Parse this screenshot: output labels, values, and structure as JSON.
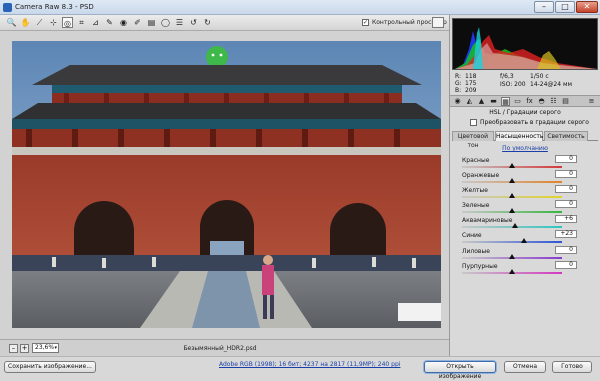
{
  "window": {
    "title": "Camera Raw 8.3  -  PSD",
    "min": "–",
    "max": "□",
    "close": "✕"
  },
  "toolbar": {
    "tools": [
      {
        "name": "zoom-tool",
        "glyph": "🔍"
      },
      {
        "name": "hand-tool",
        "glyph": "✋"
      },
      {
        "name": "white-balance-tool",
        "glyph": "⟋"
      },
      {
        "name": "color-sampler-tool",
        "glyph": "⊹"
      },
      {
        "name": "targeted-adjustment-tool",
        "glyph": "◎"
      },
      {
        "name": "crop-tool",
        "glyph": "⌗"
      },
      {
        "name": "straighten-tool",
        "glyph": "⊿"
      },
      {
        "name": "spot-removal-tool",
        "glyph": "✎"
      },
      {
        "name": "red-eye-tool",
        "glyph": "◉"
      },
      {
        "name": "adjustment-brush-tool",
        "glyph": "✐"
      },
      {
        "name": "graduated-filter-tool",
        "glyph": "▤"
      },
      {
        "name": "radial-filter-tool",
        "glyph": "◯"
      },
      {
        "name": "preferences-tool",
        "glyph": "☰"
      },
      {
        "name": "rotate-left-tool",
        "glyph": "↺"
      },
      {
        "name": "rotate-right-tool",
        "glyph": "↻"
      }
    ],
    "preview_label": "Контрольный просмотр",
    "preview_checked": "✓"
  },
  "statusbar": {
    "zoom_out": "–",
    "zoom_in": "+",
    "zoom_value": "23,6%",
    "zoom_arrow": "▾",
    "filename": "Безымянный_HDR2.psd"
  },
  "camera_info": {
    "r_label": "R:",
    "r_value": "118",
    "g_label": "G:",
    "g_value": "175",
    "b_label": "B:",
    "b_value": "209",
    "aperture": "f/6,3",
    "shutter": "1/50 с",
    "iso": "ISO: 200",
    "lens": "14-24@24 мм"
  },
  "panel": {
    "title": "HSL / Градации серого",
    "convert_label": "Преобразовать в градации серого",
    "tabs": [
      "Цветовой тон",
      "Насыщенность",
      "Светимость"
    ],
    "active_tab": 1,
    "defaults_link": "По умолчанию",
    "sliders": [
      {
        "label": "Красные",
        "value": "0",
        "pos": 0.5,
        "gradient": "linear-gradient(90deg,#c8c8c8,#d23a3a)"
      },
      {
        "label": "Оранжевые",
        "value": "0",
        "pos": 0.5,
        "gradient": "linear-gradient(90deg,#c8c8c8,#e0842a)"
      },
      {
        "label": "Желтые",
        "value": "0",
        "pos": 0.5,
        "gradient": "linear-gradient(90deg,#c8c8c8,#e2d22d)"
      },
      {
        "label": "Зеленые",
        "value": "0",
        "pos": 0.5,
        "gradient": "linear-gradient(90deg,#c8c8c8,#39b53f)"
      },
      {
        "label": "Аквамариновые",
        "value": "+6",
        "pos": 0.53,
        "gradient": "linear-gradient(90deg,#c8c8c8,#2fc6c0)"
      },
      {
        "label": "Синие",
        "value": "+23",
        "pos": 0.615,
        "gradient": "linear-gradient(90deg,#c8c8c8,#2f55d6)"
      },
      {
        "label": "Лиловые",
        "value": "0",
        "pos": 0.5,
        "gradient": "linear-gradient(90deg,#c8c8c8,#8a3ad0)"
      },
      {
        "label": "Пурпурные",
        "value": "0",
        "pos": 0.5,
        "gradient": "linear-gradient(90deg,#c8c8c8,#d23ac0)"
      }
    ]
  },
  "bottom": {
    "save_label": "Сохранить изображение...",
    "info_link": "Adobe RGB (1998); 16 бит; 4237 на 2817 (11,9МР); 240 ppi",
    "open_label": "Открыть изображение",
    "cancel_label": "Отмена",
    "done_label": "Готово"
  },
  "colors": {
    "accent": "#3d6ca8",
    "link": "#1a3fa8",
    "wall": "#a8442f",
    "sky": "#6b8fb4"
  }
}
